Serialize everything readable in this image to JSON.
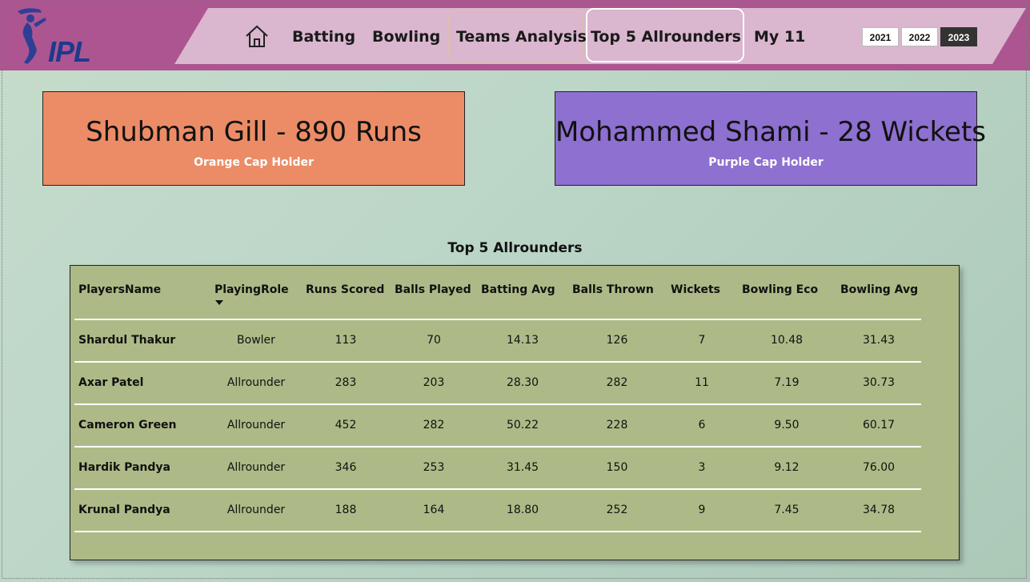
{
  "logo": {
    "text": "IPL"
  },
  "nav": {
    "items": [
      "Batting",
      "Bowling",
      "Teams Analysis",
      "Top 5 Allrounders",
      "My 11"
    ],
    "years": [
      "2021",
      "2022",
      "2023"
    ],
    "selected_year": "2023"
  },
  "cards": {
    "orange": {
      "main": "Shubman Gill - 890 Runs",
      "sub": "Orange Cap Holder",
      "color": "#ec8c67"
    },
    "purple": {
      "main": "Mohammed Shami - 28 Wickets",
      "sub": "Purple Cap Holder",
      "color": "#8d70cf"
    }
  },
  "table": {
    "title": "Top 5 Allrounders",
    "columns": [
      "PlayersName",
      "PlayingRole",
      "Runs Scored",
      "Balls Played",
      "Batting Avg",
      "Balls Thrown",
      "Wickets",
      "Bowling Eco",
      "Bowling Avg"
    ],
    "rows": [
      [
        "Shardul Thakur",
        "Bowler",
        "113",
        "70",
        "14.13",
        "126",
        "7",
        "10.48",
        "31.43"
      ],
      [
        "Axar Patel",
        "Allrounder",
        "283",
        "203",
        "28.30",
        "282",
        "11",
        "7.19",
        "30.73"
      ],
      [
        "Cameron Green",
        "Allrounder",
        "452",
        "282",
        "50.22",
        "228",
        "6",
        "9.50",
        "60.17"
      ],
      [
        "Hardik Pandya",
        "Allrounder",
        "346",
        "253",
        "31.45",
        "150",
        "3",
        "9.12",
        "76.00"
      ],
      [
        "Krunal Pandya",
        "Allrounder",
        "188",
        "164",
        "18.80",
        "252",
        "9",
        "7.45",
        "34.78"
      ]
    ]
  }
}
